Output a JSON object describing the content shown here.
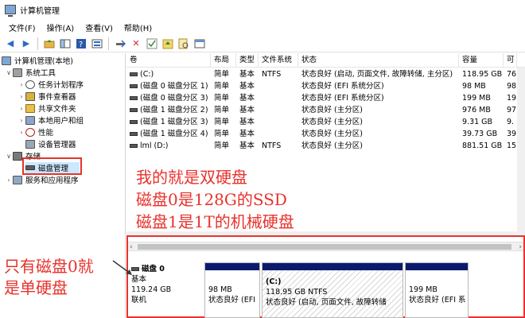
{
  "window": {
    "title": "计算机管理"
  },
  "menu": [
    "文件(F)",
    "操作(A)",
    "查看(V)",
    "帮助(H)"
  ],
  "tree": {
    "root": "计算机管理(本地)",
    "system_tools": "系统工具",
    "task_scheduler": "任务计划程序",
    "event_viewer": "事件查看器",
    "shared_folders": "共享文件夹",
    "local_users": "本地用户和组",
    "performance": "性能",
    "device_manager": "设备管理器",
    "storage": "存储",
    "disk_management": "磁盘管理",
    "services": "服务和应用程序"
  },
  "columns": [
    "卷",
    "布局",
    "类型",
    "文件系统",
    "状态",
    "容量",
    "可"
  ],
  "volumes": [
    {
      "name": "(C:)",
      "layout": "简单",
      "type": "基本",
      "fs": "NTFS",
      "status": "状态良好 (启动, 页面文件, 故障转储, 主分区)",
      "capacity": "118.95 GB",
      "free": "76"
    },
    {
      "name": "(磁盘 0 磁盘分区 1)",
      "layout": "简单",
      "type": "基本",
      "fs": "",
      "status": "状态良好 (EFI 系统分区)",
      "capacity": "98 MB",
      "free": "98"
    },
    {
      "name": "(磁盘 0 磁盘分区 3)",
      "layout": "简单",
      "type": "基本",
      "fs": "",
      "status": "状态良好 (EFI 系统分区)",
      "capacity": "199 MB",
      "free": "19"
    },
    {
      "name": "(磁盘 1 磁盘分区 2)",
      "layout": "简单",
      "type": "基本",
      "fs": "",
      "status": "状态良好 (主分区)",
      "capacity": "976 MB",
      "free": "97"
    },
    {
      "name": "(磁盘 1 磁盘分区 3)",
      "layout": "简单",
      "type": "基本",
      "fs": "",
      "status": "状态良好 (主分区)",
      "capacity": "9.31 GB",
      "free": "9."
    },
    {
      "name": "(磁盘 1 磁盘分区 4)",
      "layout": "简单",
      "type": "基本",
      "fs": "",
      "status": "状态良好 (主分区)",
      "capacity": "39.73 GB",
      "free": "39"
    },
    {
      "name": "lml (D:)",
      "layout": "简单",
      "type": "基本",
      "fs": "NTFS",
      "status": "状态良好 (主分区)",
      "capacity": "881.51 GB",
      "free": "15"
    }
  ],
  "annotations": {
    "top": [
      "我的就是双硬盘",
      "磁盘0是128G的SSD",
      "磁盘1是1T的机械硬盘"
    ],
    "left": [
      "只有磁盘0就",
      "是单硬盘"
    ]
  },
  "disk0": {
    "name": "磁盘 0",
    "type": "基本",
    "size": "119.24 GB",
    "status": "联机",
    "partitions": [
      {
        "size": "98 MB",
        "status": "状态良好 (EFI"
      },
      {
        "label": "(C:)",
        "size": "118.95 GB NTFS",
        "status": "状态良好 (启动, 页面文件, 故障转储"
      },
      {
        "size": "199 MB",
        "status": "状态良好 (EFI 系"
      }
    ]
  },
  "colors": {
    "accent_red": "#e8322c",
    "partition_bar": "#0a1b6e",
    "selection": "#cce8ff"
  }
}
